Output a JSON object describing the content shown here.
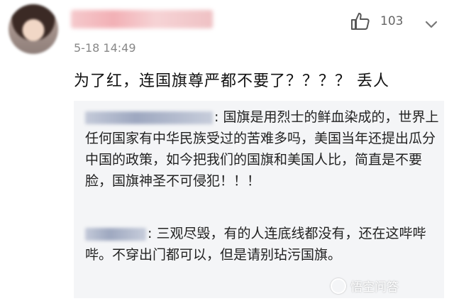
{
  "post": {
    "timestamp": "5-18 14:49",
    "like_count": "103",
    "comment_text": "为了红，连国旗尊严都不要了？？？？ 丢人"
  },
  "replies": [
    {
      "text": ": 国旗是用烈士的鲜血染成的，世界上任何国家有中华民族受过的苦难多吗，美国当年还提出瓜分中国的政策，如今把我们的国旗和美国人比，简直是不要脸，国旗神圣不可侵犯！！！"
    },
    {
      "text": ": 三观尽毁，有的人连底线都没有，还在这哔哔哔。不穿出门都可以，但是请别玷污国旗。"
    }
  ],
  "watermark": {
    "label": "悟空问答"
  },
  "icons": {
    "like": "thumbs-up-icon",
    "more": "chevron-down-icon",
    "watermark": "wukong-logo-icon"
  },
  "colors": {
    "timestamp": "#888888",
    "quote_bg": "#f4f5f7"
  }
}
